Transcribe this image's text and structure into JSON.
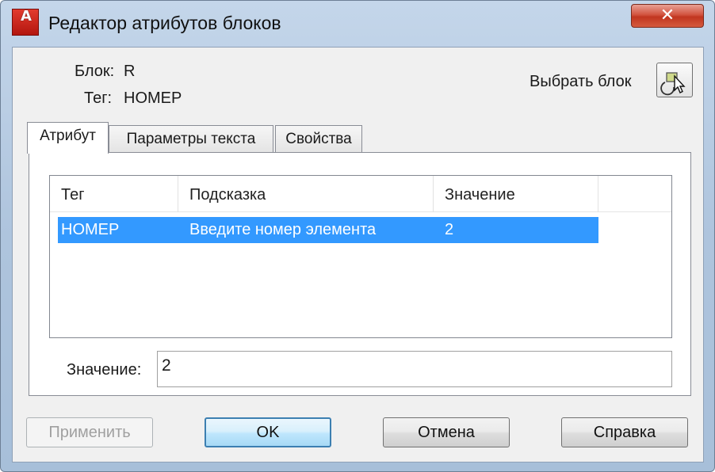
{
  "window": {
    "title": "Редактор атрибутов блоков",
    "close_glyph": "✕",
    "app_icon_letter": "A",
    "icons": [
      "autocad-app-icon",
      "close-icon",
      "select-object-icon"
    ]
  },
  "header": {
    "block_label": "Блок:",
    "block_value": "R",
    "tag_label": "Тег:",
    "tag_value": "НОМЕР",
    "select_block_label": "Выбрать блок"
  },
  "tabs": [
    {
      "label": "Атрибут",
      "active": true
    },
    {
      "label": "Параметры текста",
      "active": false
    },
    {
      "label": "Свойства",
      "active": false
    }
  ],
  "attribute_table": {
    "columns": [
      "Тег",
      "Подсказка",
      "Значение"
    ],
    "rows": [
      {
        "tag": "НОМЕР",
        "prompt": "Введите номер элемента",
        "value": "2",
        "selected": true
      }
    ]
  },
  "value_field": {
    "label": "Значение:",
    "value": "2"
  },
  "buttons": {
    "apply": "Применить",
    "ok": "OK",
    "cancel": "Отмена",
    "help": "Справка"
  },
  "colors": {
    "selection": "#3399ff",
    "title_gradient_top": "#c4d6ea",
    "close_button": "#c1351f",
    "default_button_border": "#3c7fb1"
  }
}
